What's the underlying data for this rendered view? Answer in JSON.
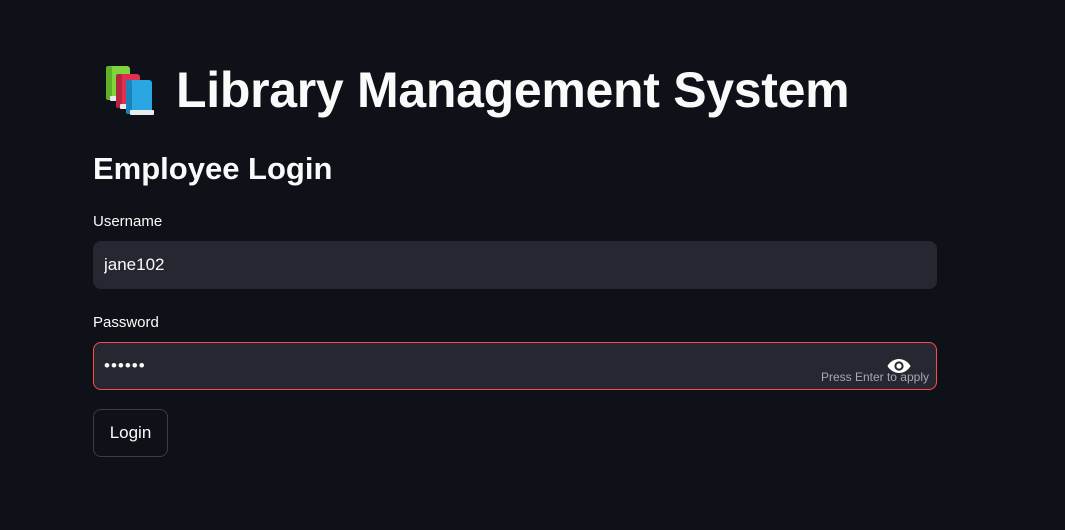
{
  "header": {
    "icon": "books-icon",
    "title": "Library Management System"
  },
  "login": {
    "heading": "Employee Login",
    "username": {
      "label": "Username",
      "value": "jane102"
    },
    "password": {
      "label": "Password",
      "value": "••••••",
      "hint": "Press Enter to apply",
      "toggle_icon": "eye-icon"
    },
    "button_label": "Login"
  },
  "colors": {
    "background": "#0e1117",
    "input_background": "#262730",
    "error_border": "#ff4b4b",
    "text": "#fafafa",
    "hint_text": "#a3a8b8",
    "book_green": "#7ed63c",
    "book_red": "#e03050",
    "book_blue": "#2aa7e3"
  }
}
